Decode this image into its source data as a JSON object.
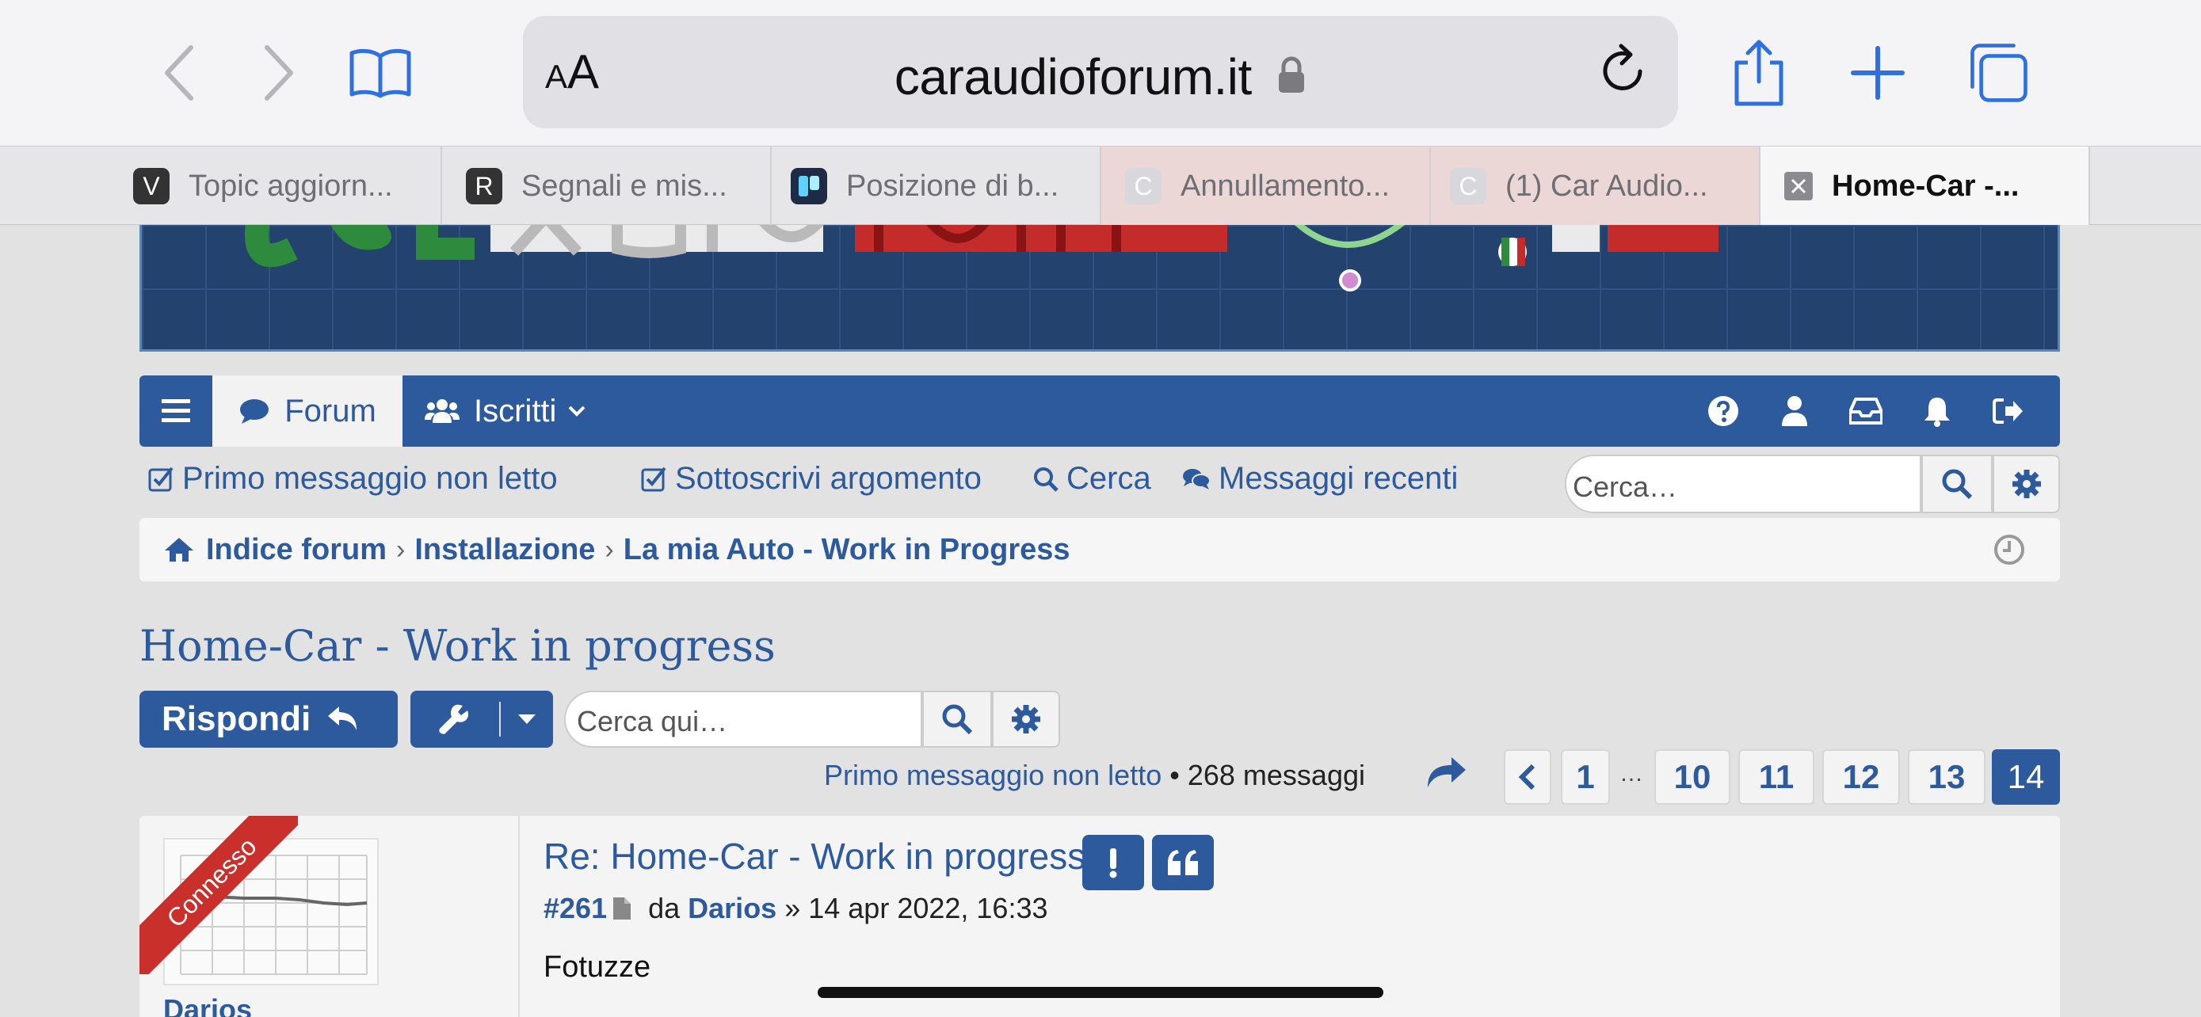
{
  "browser": {
    "reader_button": "AA",
    "url": "caraudioforum.it",
    "tabs": [
      {
        "icon_letter": "V",
        "title": "Topic aggiorn...",
        "active": false,
        "icon_bg": "#333333"
      },
      {
        "icon_letter": "R",
        "title": "Segnali e mis...",
        "active": false,
        "icon_bg": "#333333"
      },
      {
        "icon_letter": "",
        "title": "Posizione di b...",
        "active": false,
        "icon_bg": "#1f2a44"
      },
      {
        "icon_letter": "C",
        "title": "Annullamento...",
        "active": false,
        "icon_bg": "#c9c9cf"
      },
      {
        "icon_letter": "C",
        "title": "(1) Car Audio...",
        "active": false,
        "icon_bg": "#c9c9cf"
      },
      {
        "icon_letter": "",
        "title": "Home-Car -...",
        "active": true,
        "icon_bg": "#8a8a8f"
      }
    ]
  },
  "banner": {
    "logo_text": "CarAudioForum.it"
  },
  "navbar": {
    "forum_label": "Forum",
    "members_label": "Iscritti"
  },
  "actions": {
    "first_unread": "Primo messaggio non letto",
    "subscribe": "Sottoscrivi argomento",
    "search": "Cerca",
    "recent": "Messaggi recenti",
    "search_placeholder": "Cerca…"
  },
  "breadcrumb": {
    "items": [
      "Indice forum",
      "Installazione",
      "La mia Auto - Work in Progress"
    ]
  },
  "topic": {
    "title": "Home-Car - Work in progress",
    "reply_label": "Rispondi",
    "search_placeholder": "Cerca qui…"
  },
  "pagination": {
    "first_unread": "Primo messaggio non letto",
    "bullet": "•",
    "count": "268 messaggi",
    "pages": [
      "1",
      "10",
      "11",
      "12",
      "13",
      "14"
    ],
    "ellipsis": "…",
    "current": "14"
  },
  "post": {
    "online_label": "Connesso",
    "author": "Darios",
    "title": "Re: Home-Car - Work in progress",
    "number": "#261",
    "by": "da",
    "author_meta": "Darios",
    "date": "» 14 apr 2022, 16:33",
    "content": "Fotuzze"
  },
  "colors": {
    "primary": "#2d5a9c",
    "online_ribbon": "#c9302c",
    "browser_accent": "#2f6fde"
  }
}
